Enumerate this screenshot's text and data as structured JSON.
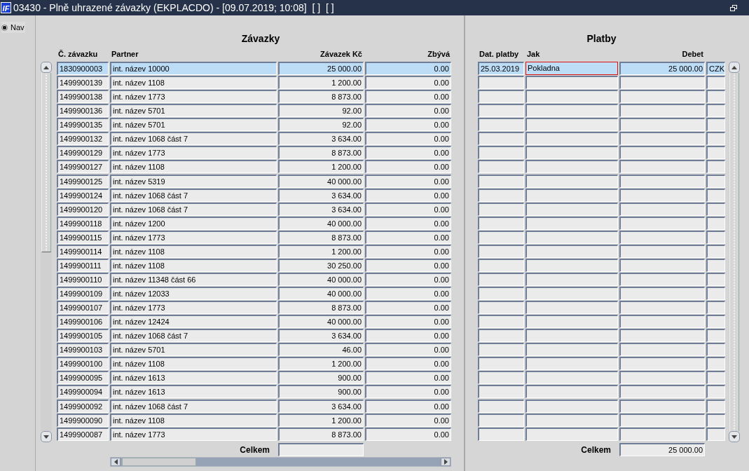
{
  "window": {
    "logo": "IF",
    "title": "03430 - Plně uhrazené závazky (EKPLACDO) - [09.07.2019; 10:08]  [ ]  [ ]"
  },
  "nav": {
    "label": "Nav",
    "checked": true
  },
  "liabilities": {
    "title": "Závazky",
    "columns": [
      "Č. závazku",
      "Partner",
      "Závazek Kč",
      "Zbývá"
    ],
    "rows": [
      {
        "number": "1830900003",
        "partner": "int. název 10000",
        "amount": "25 000.00",
        "remaining": "0.00",
        "selected": true
      },
      {
        "number": "1499900139",
        "partner": "int. název 1108",
        "amount": "1 200.00",
        "remaining": "0.00",
        "selected": false
      },
      {
        "number": "1499900138",
        "partner": "int. název 1773",
        "amount": "8 873.00",
        "remaining": "0.00",
        "selected": false
      },
      {
        "number": "1499900136",
        "partner": "int. název 5701",
        "amount": "92.00",
        "remaining": "0.00",
        "selected": false
      },
      {
        "number": "1499900135",
        "partner": "int. název 5701",
        "amount": "92.00",
        "remaining": "0.00",
        "selected": false
      },
      {
        "number": "1499900132",
        "partner": "int. název 1068 část 7",
        "amount": "3 634.00",
        "remaining": "0.00",
        "selected": false
      },
      {
        "number": "1499900129",
        "partner": "int. název 1773",
        "amount": "8 873.00",
        "remaining": "0.00",
        "selected": false
      },
      {
        "number": "1499900127",
        "partner": "int. název 1108",
        "amount": "1 200.00",
        "remaining": "0.00",
        "selected": false
      },
      {
        "number": "1499900125",
        "partner": "int. název 5319",
        "amount": "40 000.00",
        "remaining": "0.00",
        "selected": false
      },
      {
        "number": "1499900124",
        "partner": "int. název 1068 část 7",
        "amount": "3 634.00",
        "remaining": "0.00",
        "selected": false
      },
      {
        "number": "1499900120",
        "partner": "int. název 1068 část 7",
        "amount": "3 634.00",
        "remaining": "0.00",
        "selected": false
      },
      {
        "number": "1499900118",
        "partner": "int. název 1200",
        "amount": "40 000.00",
        "remaining": "0.00",
        "selected": false
      },
      {
        "number": "1499900115",
        "partner": "int. název 1773",
        "amount": "8 873.00",
        "remaining": "0.00",
        "selected": false
      },
      {
        "number": "1499900114",
        "partner": "int. název 1108",
        "amount": "1 200.00",
        "remaining": "0.00",
        "selected": false
      },
      {
        "number": "1499900111",
        "partner": "int. název 1108",
        "amount": "30 250.00",
        "remaining": "0.00",
        "selected": false
      },
      {
        "number": "1499900110",
        "partner": "int. název 11348 část 66",
        "amount": "40 000.00",
        "remaining": "0.00",
        "selected": false
      },
      {
        "number": "1499900109",
        "partner": "int. název 12033",
        "amount": "40 000.00",
        "remaining": "0.00",
        "selected": false
      },
      {
        "number": "1499900107",
        "partner": "int. název 1773",
        "amount": "8 873.00",
        "remaining": "0.00",
        "selected": false
      },
      {
        "number": "1499900106",
        "partner": "int. název 12424",
        "amount": "40 000.00",
        "remaining": "0.00",
        "selected": false
      },
      {
        "number": "1499900105",
        "partner": "int. název 1068 část 7",
        "amount": "3 634.00",
        "remaining": "0.00",
        "selected": false
      },
      {
        "number": "1499900103",
        "partner": "int. název 5701",
        "amount": "46.00",
        "remaining": "0.00",
        "selected": false
      },
      {
        "number": "1499900100",
        "partner": "int. název 1108",
        "amount": "1 200.00",
        "remaining": "0.00",
        "selected": false
      },
      {
        "number": "1499900095",
        "partner": "int. název 1613",
        "amount": "900.00",
        "remaining": "0.00",
        "selected": false
      },
      {
        "number": "1499900094",
        "partner": "int. název 1613",
        "amount": "900.00",
        "remaining": "0.00",
        "selected": false
      },
      {
        "number": "1499900092",
        "partner": "int. název 1068 část 7",
        "amount": "3 634.00",
        "remaining": "0.00",
        "selected": false
      },
      {
        "number": "1499900090",
        "partner": "int. název 1108",
        "amount": "1 200.00",
        "remaining": "0.00",
        "selected": false
      },
      {
        "number": "1499900087",
        "partner": "int. název 1773",
        "amount": "8 873.00",
        "remaining": "0.00",
        "selected": false
      }
    ],
    "total_label": "Celkem"
  },
  "payments": {
    "title": "Platby",
    "columns": [
      "Dat. platby",
      "Jak",
      "Debet"
    ],
    "rows": [
      {
        "date": "25.03.2019",
        "method": "Pokladna",
        "amount": "25 000.00",
        "currency": "CZK",
        "selected": true,
        "focused": true
      }
    ],
    "total_label": "Celkem",
    "total": "25 000.00"
  }
}
